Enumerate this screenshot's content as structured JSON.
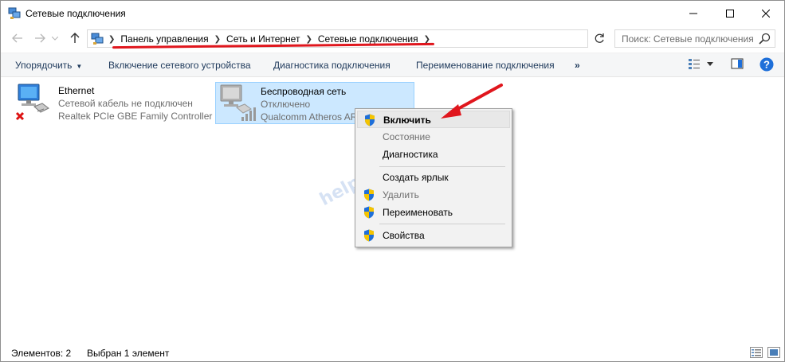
{
  "window": {
    "title": "Сетевые подключения"
  },
  "address": {
    "crumbs": [
      "Панель управления",
      "Сеть и Интернет",
      "Сетевые подключения"
    ]
  },
  "search": {
    "placeholder": "Поиск: Сетевые подключения"
  },
  "commands": {
    "organize": "Упорядочить",
    "enable_device": "Включение сетевого устройства",
    "diagnose": "Диагностика подключения",
    "rename": "Переименование подключения",
    "more": "»"
  },
  "connections": [
    {
      "name": "Ethernet",
      "status": "Сетевой кабель не подключен",
      "device": "Realtek PCIe GBE Family Controller",
      "selected": false
    },
    {
      "name": "Беспроводная сеть",
      "status": "Отключено",
      "device": "Qualcomm Atheros AR",
      "selected": true
    }
  ],
  "context_menu": {
    "items": [
      {
        "label": "Включить",
        "shield": true,
        "bold": true,
        "disabled": false,
        "highlighted": true
      },
      {
        "label": "Состояние",
        "shield": false,
        "bold": false,
        "disabled": true
      },
      {
        "label": "Диагностика",
        "shield": false,
        "bold": false,
        "disabled": false
      },
      {
        "label": "Создать ярлык",
        "shield": false,
        "bold": false,
        "disabled": false
      },
      {
        "label": "Удалить",
        "shield": true,
        "bold": false,
        "disabled": true
      },
      {
        "label": "Переименовать",
        "shield": true,
        "bold": false,
        "disabled": false
      },
      {
        "label": "Свойства",
        "shield": true,
        "bold": false,
        "disabled": false
      }
    ]
  },
  "watermark": "help-wifi.com",
  "status": {
    "count": "Элементов: 2",
    "selected": "Выбран 1 элемент"
  },
  "colors": {
    "accent": "#0078d7",
    "selection": "#cce8ff",
    "arrow": "#e0161d",
    "help": "#1e6fd9"
  },
  "icons": {
    "app": "network-connections-icon",
    "back": "back-arrow-icon",
    "forward": "forward-arrow-icon",
    "up": "up-arrow-icon",
    "refresh": "refresh-icon",
    "search": "search-icon",
    "help": "help-icon",
    "shield": "uac-shield-icon"
  }
}
